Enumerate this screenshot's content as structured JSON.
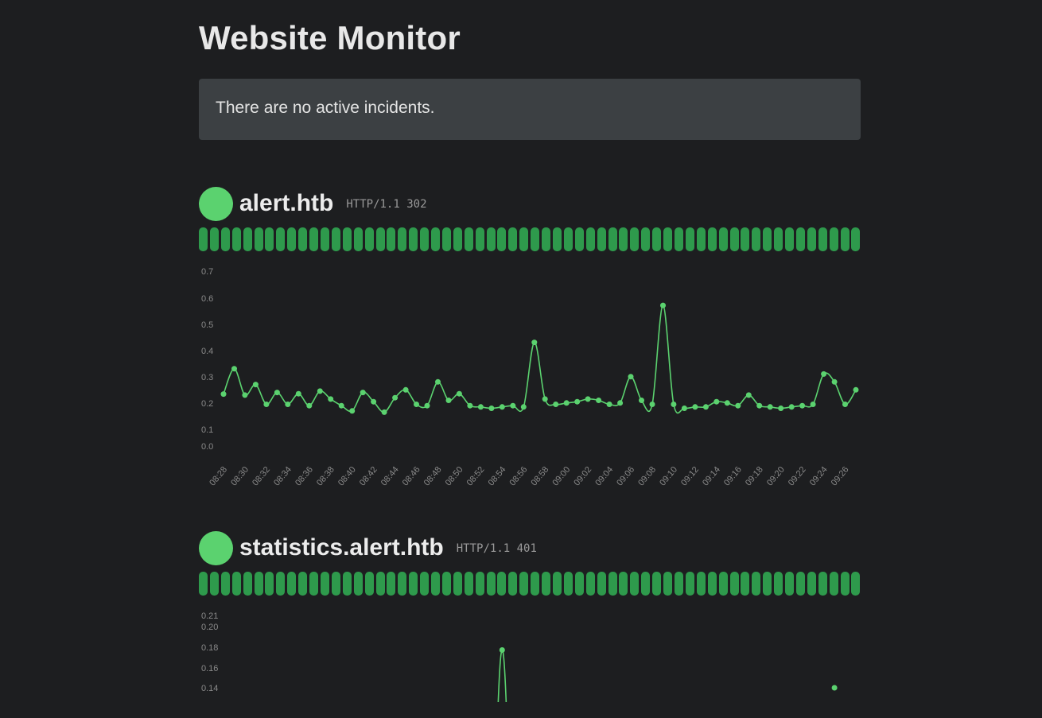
{
  "page": {
    "title": "Website Monitor"
  },
  "incidents": {
    "message": "There are no active incidents."
  },
  "colors": {
    "background": "#1d1e20",
    "panel": "#3c4043",
    "up": "#5bd26f",
    "bar": "#2e9a4c"
  },
  "sites": [
    {
      "name": "alert.htb",
      "status": "HTTP/1.1 302",
      "status_icon": "status-up-dot",
      "uptime_checks": 60,
      "chart_data": {
        "type": "line",
        "title": "",
        "xlabel": "",
        "ylabel": "",
        "y_ticks": [
          "0.0",
          "0.1",
          "0.2",
          "0.3",
          "0.4",
          "0.5",
          "0.6",
          "0.7"
        ],
        "ylim": [
          0,
          0.7
        ],
        "x_tick_labels": [
          "08:28",
          "08:30",
          "08:32",
          "08:34",
          "08:36",
          "08:38",
          "08:40",
          "08:42",
          "08:44",
          "08:46",
          "08:48",
          "08:50",
          "08:52",
          "08:54",
          "08:56",
          "08:58",
          "09:00",
          "09:02",
          "09:04",
          "09:06",
          "09:08",
          "09:10",
          "09:12",
          "09:14",
          "09:16",
          "09:18",
          "09:20",
          "09:22",
          "09:24",
          "09:26"
        ],
        "x_start": "08:28",
        "x_end": "09:27",
        "values": [
          0.234,
          0.33,
          0.23,
          0.27,
          0.195,
          0.24,
          0.195,
          0.235,
          0.19,
          0.245,
          0.215,
          0.19,
          0.17,
          0.24,
          0.205,
          0.165,
          0.22,
          0.25,
          0.195,
          0.19,
          0.28,
          0.21,
          0.235,
          0.19,
          0.185,
          0.18,
          0.185,
          0.19,
          0.185,
          0.43,
          0.215,
          0.195,
          0.2,
          0.205,
          0.215,
          0.21,
          0.195,
          0.2,
          0.3,
          0.21,
          0.195,
          0.57,
          0.195,
          0.18,
          0.185,
          0.185,
          0.205,
          0.2,
          0.19,
          0.23,
          0.19,
          0.185,
          0.18,
          0.185,
          0.19,
          0.195,
          0.31,
          0.28,
          0.195,
          0.25
        ]
      }
    },
    {
      "name": "statistics.alert.htb",
      "status": "HTTP/1.1 401",
      "status_icon": "status-up-dot",
      "uptime_checks": 60,
      "chart_data": {
        "type": "line",
        "title": "",
        "xlabel": "",
        "ylabel": "",
        "y_ticks": [
          "0.14",
          "0.16",
          "0.18",
          "0.20",
          "0.21"
        ],
        "visible_values": [
          {
            "x_index": 26,
            "y": 0.177
          },
          {
            "x_index": 57,
            "y": 0.14
          }
        ]
      }
    }
  ]
}
